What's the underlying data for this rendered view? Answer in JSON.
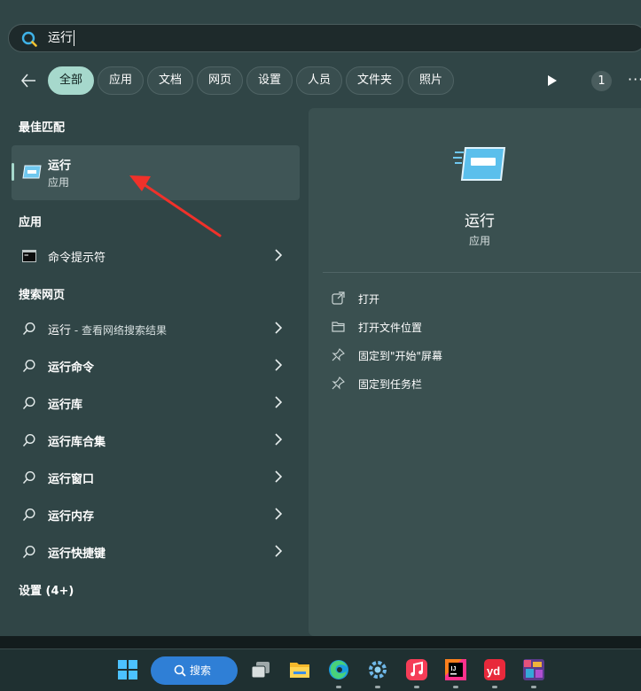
{
  "search": {
    "value": "运行"
  },
  "filters": {
    "chips": [
      "全部",
      "应用",
      "文档",
      "网页",
      "设置",
      "人员",
      "文件夹",
      "照片"
    ],
    "active": "全部",
    "badge": "1"
  },
  "left": {
    "best_match_header": "最佳匹配",
    "best_match": {
      "title": "运行",
      "subtitle": "应用"
    },
    "apps_header": "应用",
    "apps": [
      {
        "label": "命令提示符"
      }
    ],
    "web_header": "搜索网页",
    "web_results": [
      {
        "label": "运行",
        "suffix": " - 查看网络搜索结果"
      },
      {
        "label": "运行命令",
        "suffix": ""
      },
      {
        "label": "运行库",
        "suffix": ""
      },
      {
        "label": "运行库合集",
        "suffix": ""
      },
      {
        "label": "运行窗口",
        "suffix": ""
      },
      {
        "label": "运行内存",
        "suffix": ""
      },
      {
        "label": "运行快捷键",
        "suffix": ""
      }
    ],
    "settings_header": "设置 (4+)"
  },
  "right": {
    "title": "运行",
    "subtitle": "应用",
    "actions": [
      {
        "label": "打开",
        "icon": "open-external-icon"
      },
      {
        "label": "打开文件位置",
        "icon": "folder-icon"
      },
      {
        "label": "固定到\"开始\"屏幕",
        "icon": "pin-icon"
      },
      {
        "label": "固定到任务栏",
        "icon": "pin-icon"
      }
    ]
  },
  "taskbar": {
    "search_label": "搜索",
    "items": [
      "start-icon",
      "search-button",
      "task-view-icon",
      "file-explorer-icon",
      "edge-icon",
      "settings-app-icon",
      "music-icon",
      "intellij-icon",
      "youdao-icon",
      "photo-app-icon"
    ]
  },
  "colors": {
    "accent": "#a6d8cc",
    "window_bg": "#304546",
    "panel_bg": "#3a5050",
    "annotation_arrow": "#f0312a"
  }
}
